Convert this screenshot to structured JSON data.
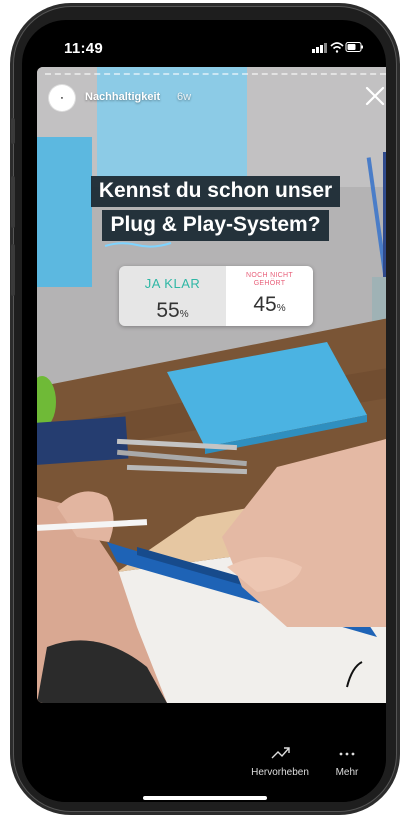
{
  "status_bar": {
    "time": "11:49"
  },
  "story": {
    "account_name": "Nachhaltigkeit",
    "age": "6w",
    "headline_line1": "Kennst du schon unser",
    "headline_line2": "Plug & Play-System?",
    "poll": {
      "option1": {
        "label": "JA KLAR",
        "percent": "55",
        "color": "#2fb7a5"
      },
      "option2": {
        "label_line1": "NOCH NICHT",
        "label_line2": "GEHÖRT",
        "percent": "45",
        "color": "#e8607a"
      },
      "percent_sign": "%"
    }
  },
  "bottom_actions": {
    "highlight_label": "Hervorheben",
    "more_label": "Mehr"
  },
  "icons": [
    "close-icon",
    "signal-icon",
    "wifi-icon",
    "battery-icon",
    "trending-arrow-icon",
    "more-dots-icon"
  ]
}
